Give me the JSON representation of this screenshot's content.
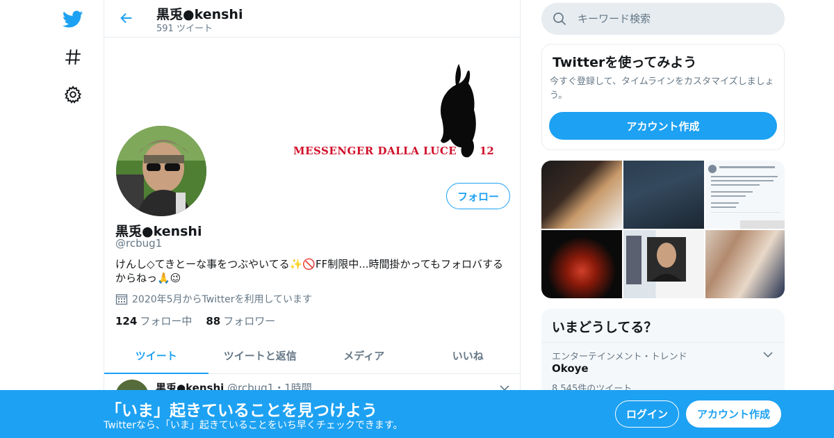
{
  "colors": {
    "accent": "#1da1f2",
    "secondary_text": "#657786",
    "border": "#e6ecf0",
    "banner_text": "#d0102a"
  },
  "nav": {
    "logo_icon": "twitter-bird-icon",
    "explore_icon": "hashtag-icon",
    "settings_icon": "gear-icon"
  },
  "header": {
    "back_icon": "back-arrow-icon",
    "name": "黒兎●kenshi",
    "tweet_count": "591 ツイート"
  },
  "banner": {
    "text": "MESSENGER DALLA LUCE",
    "number": "12"
  },
  "profile": {
    "name": "黒兎●kenshi",
    "handle": "@rcbug1",
    "bio": "けんし◇てきとーな事をつぶやいてる✨🚫FF制限中...時間掛かってもフォロバするからねっ🙏😉",
    "joined": "2020年5月からTwitterを利用しています",
    "following_count": "124",
    "following_label": "フォロー中",
    "followers_count": "88",
    "followers_label": "フォロワー",
    "follow_button": "フォロー"
  },
  "tabs": [
    {
      "label": "ツイート",
      "active": true
    },
    {
      "label": "ツイートと返信",
      "active": false
    },
    {
      "label": "メディア",
      "active": false
    },
    {
      "label": "いいね",
      "active": false
    }
  ],
  "tweet": {
    "name": "黒兎●kenshi",
    "meta": "@rcbug1・1時間"
  },
  "search": {
    "placeholder": "キーワード検索"
  },
  "signup_card": {
    "title": "Twitterを使ってみよう",
    "desc": "今すぐ登録して、タイムラインをカスタマイズしましょう。",
    "button": "アカウント作成"
  },
  "trends": {
    "title": "いまどうしてる？",
    "items": [
      {
        "meta": "エンターテインメント・トレンド",
        "name": "Okoye",
        "count": "8,545件のツイート"
      }
    ]
  },
  "bottom_bar": {
    "title": "「いま」起きていることを見つけよう",
    "subtitle": "Twitterなら、「いま」起きていることをいち早くチェックできます。",
    "login": "ログイン",
    "signup": "アカウント作成"
  }
}
